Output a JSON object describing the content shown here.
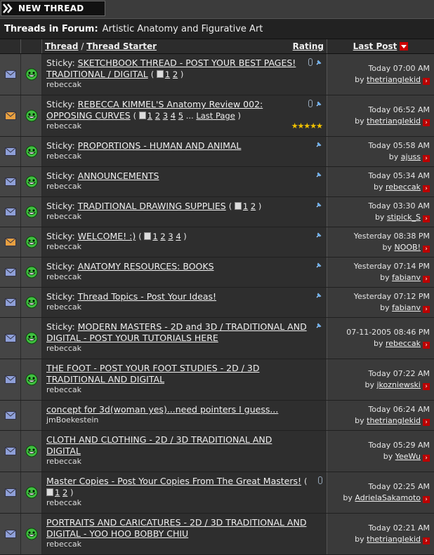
{
  "toolbar": {
    "new_thread_label": "NEW THREAD"
  },
  "forum": {
    "prefix": "Threads in Forum",
    "name": "Artistic Anatomy and Figurative Art"
  },
  "columns": {
    "thread": "Thread",
    "separator": "/",
    "starter": "Thread Starter",
    "rating": "Rating",
    "last_post": "Last Post"
  },
  "threads": [
    {
      "sticky": "Sticky:",
      "title": "SKETCHBOOK THREAD - POST YOUR BEST PAGES! TRADITIONAL / DIGITAL",
      "pages": [
        "1",
        "2"
      ],
      "starter": "rebeccak",
      "date": "Today",
      "time": "07:00 AM",
      "by": "thetrianglekid",
      "clip": true,
      "pin": true,
      "new": false
    },
    {
      "sticky": "Sticky:",
      "title": "REBECCA KIMMEL'S Anatomy Review 002: OPPOSING CURVES",
      "pages": [
        "1",
        "2",
        "3",
        "4",
        "5"
      ],
      "last_page": "Last Page",
      "starter": "rebeccak",
      "date": "Today",
      "time": "06:52 AM",
      "by": "thetrianglekid",
      "clip": true,
      "pin": true,
      "new": true,
      "stars": "★★★★★"
    },
    {
      "sticky": "Sticky:",
      "title": "PROPORTIONS - HUMAN AND ANIMAL",
      "pages": [],
      "starter": "rebeccak",
      "date": "Today",
      "time": "05:58 AM",
      "by": "ajuss",
      "clip": false,
      "pin": true,
      "new": false
    },
    {
      "sticky": "Sticky:",
      "title": "ANNOUNCEMENTS",
      "pages": [],
      "starter": "rebeccak",
      "date": "Today",
      "time": "05:34 AM",
      "by": "rebeccak",
      "clip": false,
      "pin": true,
      "new": false
    },
    {
      "sticky": "Sticky:",
      "title": "TRADITIONAL DRAWING SUPPLIES",
      "pages": [
        "1",
        "2"
      ],
      "starter": "rebeccak",
      "date": "Today",
      "time": "03:30 AM",
      "by": "stipick_S",
      "clip": false,
      "pin": true,
      "new": false
    },
    {
      "sticky": "Sticky:",
      "title": "WELCOME! :)",
      "pages": [
        "1",
        "2",
        "3",
        "4"
      ],
      "starter": "rebeccak",
      "date": "Yesterday",
      "time": "08:38 PM",
      "by": "NOOB!",
      "clip": false,
      "pin": true,
      "new": true
    },
    {
      "sticky": "Sticky:",
      "title": "ANATOMY RESOURCES: BOOKS",
      "pages": [],
      "starter": "rebeccak",
      "date": "Yesterday",
      "time": "07:14 PM",
      "by": "fabianv",
      "clip": false,
      "pin": true,
      "new": false
    },
    {
      "sticky": "Sticky:",
      "title": "Thread Topics - Post Your Ideas!",
      "pages": [],
      "starter": "rebeccak",
      "date": "Yesterday",
      "time": "07:12 PM",
      "by": "fabianv",
      "clip": false,
      "pin": true,
      "new": false
    },
    {
      "sticky": "Sticky:",
      "title": "MODERN MASTERS - 2D and 3D / TRADITIONAL AND DIGITAL - POST YOUR TUTORIALS HERE",
      "pages": [],
      "starter": "rebeccak",
      "date": "07-11-2005",
      "time": "08:46 PM",
      "by": "rebeccak",
      "clip": false,
      "pin": true,
      "new": false
    },
    {
      "sticky": "",
      "title": "THE FOOT - POST YOUR FOOT STUDIES - 2D / 3D TRADITIONAL AND DIGITAL",
      "pages": [],
      "starter": "rebeccak",
      "date": "Today",
      "time": "07:22 AM",
      "by": "jkozniewski",
      "clip": false,
      "pin": false,
      "new": false
    },
    {
      "sticky": "",
      "title": "concept for 3d(woman yes)...need pointers I guess...",
      "pages": [],
      "starter": "jmBoekestein",
      "date": "Today",
      "time": "06:24 AM",
      "by": "thetrianglekid",
      "clip": false,
      "pin": false,
      "new": false,
      "no_smiley": true
    },
    {
      "sticky": "",
      "title": "CLOTH AND CLOTHING - 2D / 3D TRADITIONAL AND DIGITAL",
      "pages": [],
      "starter": "rebeccak",
      "date": "Today",
      "time": "05:29 AM",
      "by": "YeeWu",
      "clip": false,
      "pin": false,
      "new": false
    },
    {
      "sticky": "",
      "title": "Master Copies - Post Your Copies From The Great Masters!",
      "pages": [
        "1",
        "2"
      ],
      "starter": "rebeccak",
      "date": "Today",
      "time": "02:25 AM",
      "by": "AdrielaSakamoto",
      "clip": true,
      "pin": false,
      "new": false
    },
    {
      "sticky": "",
      "title": "PORTRAITS AND CARICATURES - 2D / 3D TRADITIONAL AND DIGITAL - YOO HOO BOBBY CHIU",
      "pages": [],
      "starter": "rebeccak",
      "date": "Today",
      "time": "02:21 AM",
      "by": "thetrianglekid",
      "clip": false,
      "pin": false,
      "new": false
    }
  ],
  "labels": {
    "by": "by"
  },
  "colors": {
    "accent_red": "#b00000",
    "star": "#f2c200",
    "mail": "#8fa0d8",
    "mail_new": "#e8a040"
  }
}
